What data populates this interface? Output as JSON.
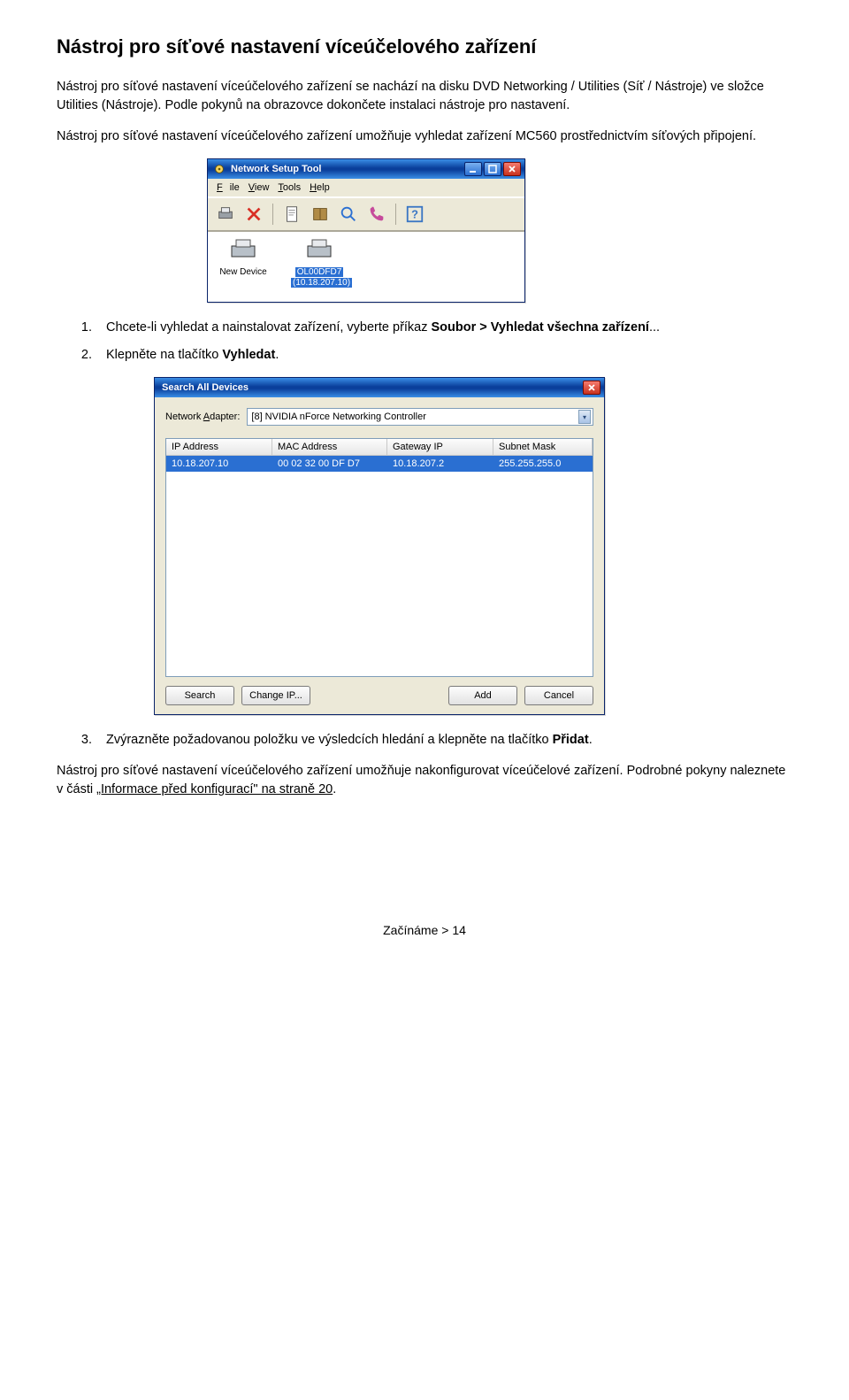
{
  "doc": {
    "heading": "Nástroj pro síťové nastavení víceúčelového zařízení",
    "p1": "Nástroj pro síťové nastavení víceúčelového zařízení se nachází na disku DVD Networking / Utilities (Síť / Nástroje) ve složce Utilities (Nástroje). Podle pokynů na obrazovce dokončete instalaci nástroje pro nastavení.",
    "p2": "Nástroj pro síťové nastavení víceúčelového zařízení umožňuje vyhledat zařízení MC560 prostřednictvím síťových připojení.",
    "li1_a": "Chcete-li vyhledat a nainstalovat zařízení, vyberte příkaz ",
    "li1_b": "Soubor > Vyhledat všechna zařízení",
    "li1_c": "...",
    "li2_a": "Klepněte na tlačítko ",
    "li2_b": "Vyhledat",
    "li2_c": ".",
    "li3_a": "Zvýrazněte požadovanou položku ve výsledcích hledání a klepněte na tlačítko ",
    "li3_b": "Přidat",
    "li3_c": ".",
    "p3_a": "Nástroj pro síťové nastavení víceúčelového zařízení umožňuje nakonfigurovat víceúčelové zařízení. Podrobné pokyny naleznete v části ",
    "p3_link": "„Informace před konfigurací\" na straně 20",
    "p3_b": ".",
    "footer": "Začínáme > 14"
  },
  "win1": {
    "title": "Network Setup Tool",
    "menu": {
      "file": "File",
      "view": "View",
      "tools": "Tools",
      "help": "Help"
    },
    "dev_new": "New Device",
    "dev_sel_name": "OL00DFD7",
    "dev_sel_ip": "(10.18.207.10)"
  },
  "win2": {
    "title": "Search All Devices",
    "adapter_label": "Network Adapter:",
    "adapter_value": "[8] NVIDIA nForce Networking Controller",
    "cols": {
      "ip": "IP Address",
      "mac": "MAC Address",
      "gw": "Gateway IP",
      "mask": "Subnet Mask"
    },
    "row": {
      "ip": "10.18.207.10",
      "mac": "00 02 32 00 DF D7",
      "gw": "10.18.207.2",
      "mask": "255.255.255.0"
    },
    "btn": {
      "search": "Search",
      "change": "Change IP...",
      "add": "Add",
      "cancel": "Cancel"
    }
  }
}
